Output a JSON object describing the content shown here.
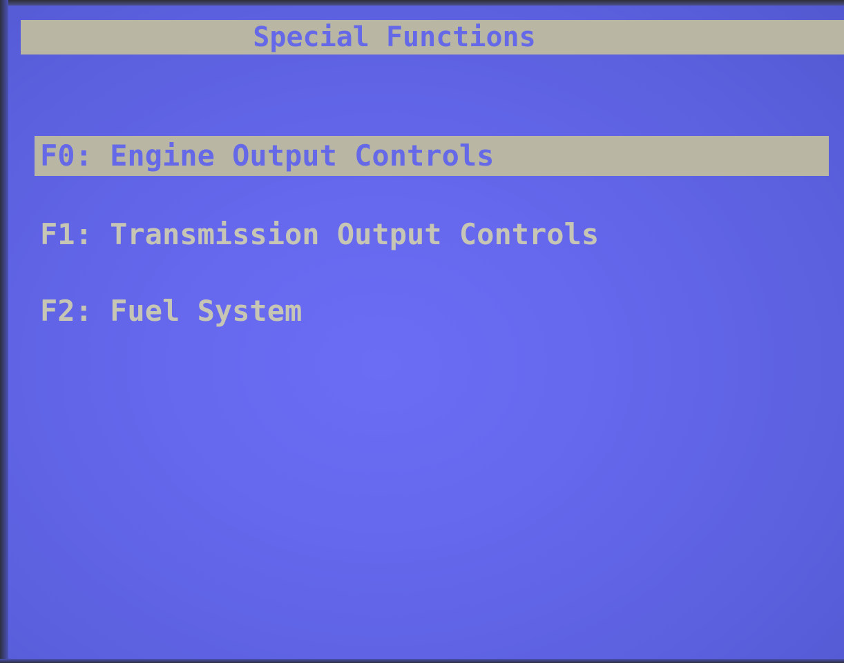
{
  "screen": {
    "title": "Special Functions",
    "menu": [
      {
        "label": "F0: Engine Output Controls",
        "selected": true
      },
      {
        "label": "F1: Transmission Output Controls",
        "selected": false
      },
      {
        "label": "F2: Fuel System",
        "selected": false
      }
    ]
  },
  "colors": {
    "background": "#6567ec",
    "highlight": "#b9b7a3",
    "text": "#c7c6b4",
    "highlight_text": "#6569e8"
  }
}
